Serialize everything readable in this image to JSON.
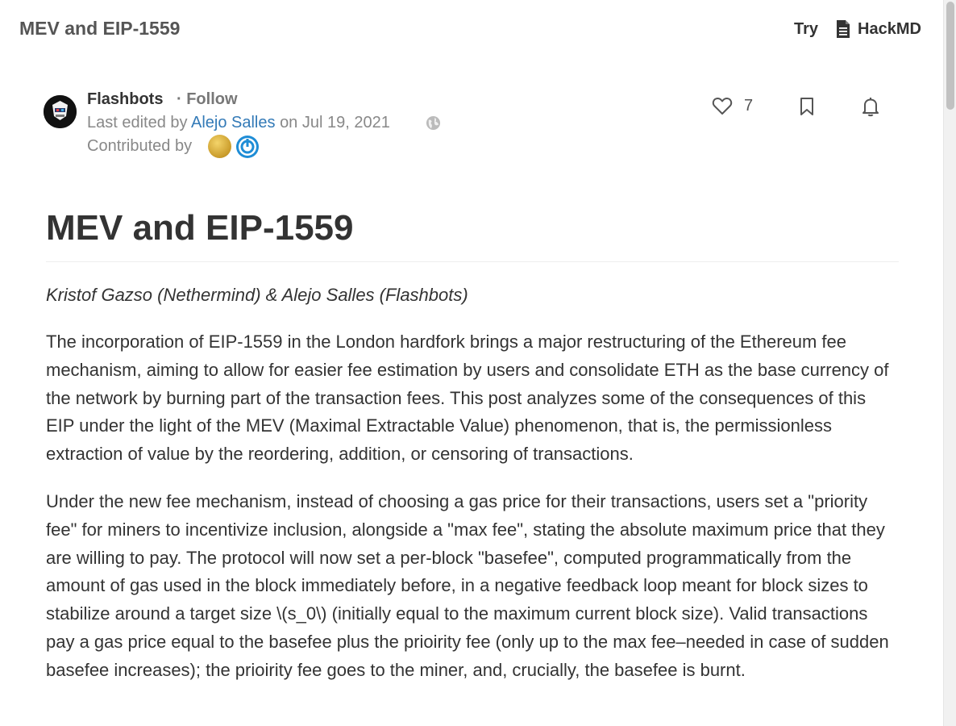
{
  "header": {
    "title": "MEV and EIP-1559",
    "try_label": "Try",
    "hackmd_label": "HackMD"
  },
  "author": {
    "name": "Flashbots",
    "follow_label": "· Follow",
    "last_edited_prefix": "Last edited by",
    "editor": "Alejo Salles",
    "edited_date": "on Jul 19, 2021",
    "contributed_by_label": "Contributed by"
  },
  "actions": {
    "like_count": "7"
  },
  "article": {
    "title": "MEV and EIP-1559",
    "authors": "Kristof Gazso (Nethermind) & Alejo Salles (Flashbots)",
    "paragraphs": [
      "The incorporation of EIP-1559 in the London hardfork brings a major restructuring of the Ethereum fee mechanism, aiming to allow for easier fee estimation by users and consolidate ETH as the base currency of the network by burning part of the transaction fees. This post analyzes some of the consequences of this EIP under the light of the MEV (Maximal Extractable Value) phenomenon, that is, the permissionless extraction of value by the reordering, addition, or censoring of transactions.",
      "Under the new fee mechanism, instead of choosing a gas price for their transactions, users set a \"priority fee\" for miners to incentivize inclusion, alongside a \"max fee\", stating the absolute maximum price that they are willing to pay. The protocol will now set a per-block \"basefee\", computed programmatically from the amount of gas used in the block immediately before, in a negative feedback loop meant for block sizes to stabilize around a target size \\(s_0\\) (initially equal to the maximum current block size). Valid transactions pay a gas price equal to the basefee plus the prioirity fee (only up to the max fee–needed in case of sudden basefee increases); the prioirity fee goes to the miner, and, crucially, the basefee is burnt."
    ]
  },
  "colors": {
    "link": "#337ab7",
    "text": "#333333",
    "muted": "#888888"
  },
  "icons": {
    "hackmd": "document-icon",
    "globe": "globe-icon",
    "like": "heart-icon",
    "bookmark": "bookmark-icon",
    "notify": "bell-icon"
  }
}
